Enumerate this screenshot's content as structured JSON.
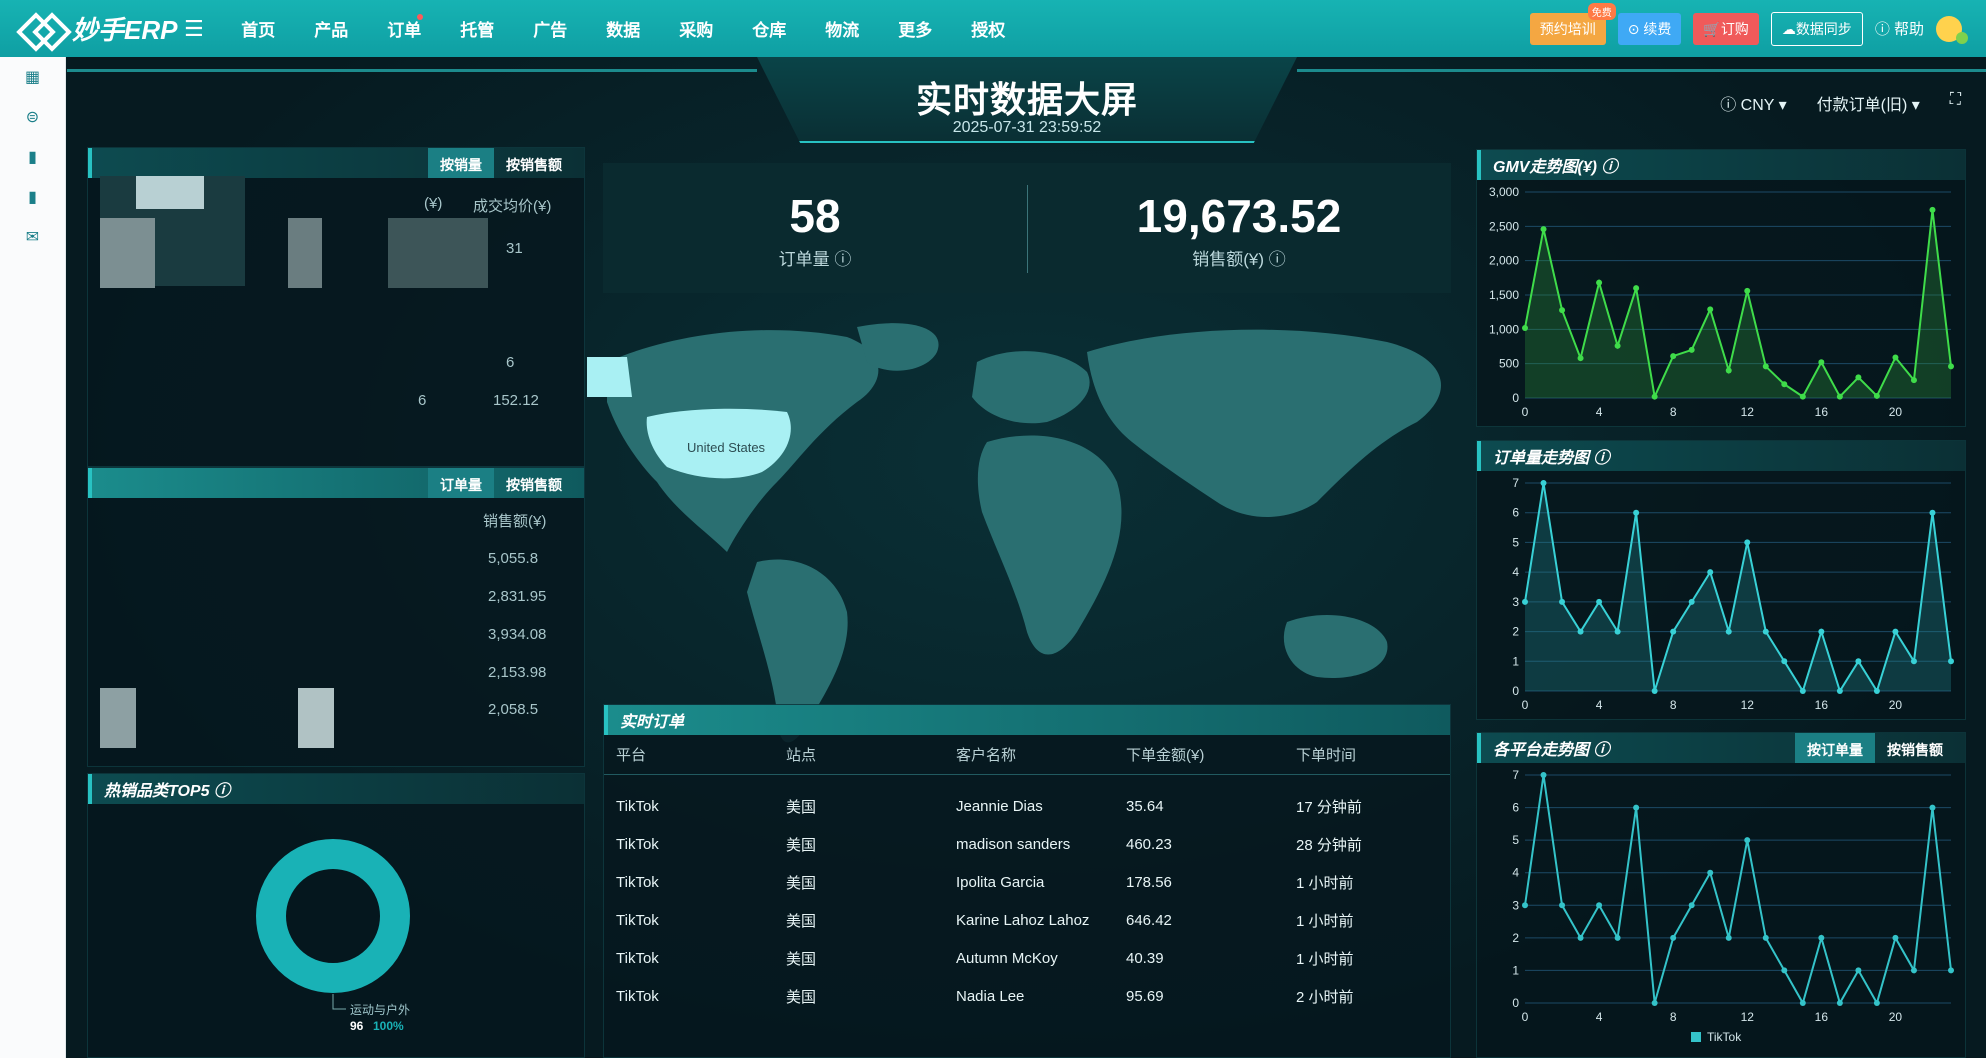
{
  "topnav": {
    "brand": "妙手ERP",
    "items": [
      "首页",
      "产品",
      "订单",
      "托管",
      "广告",
      "数据",
      "采购",
      "仓库",
      "物流",
      "更多",
      "授权"
    ],
    "training_label": "预约培训",
    "free_badge": "免费",
    "renew_label": "续费",
    "order_label": "订购",
    "sync_label": "数据同步",
    "help_label": "帮助"
  },
  "dashboard": {
    "title": "实时数据大屏",
    "datetime": "2025-07-31 23:59:52",
    "currency": "CNY",
    "order_type": "付款订单(旧)"
  },
  "left_top_panel": {
    "tab_by_volume": "按销量",
    "tab_by_sales": "按销售额",
    "col_label": "成交均价(¥)",
    "col_prefix": "(¥)",
    "values": [
      "31",
      "6",
      "6",
      "152.12"
    ]
  },
  "left_mid_panel": {
    "tab_by_orders": "订单量",
    "tab_by_sales": "按销售额",
    "col_label": "销售额(¥)",
    "values": [
      "5,055.8",
      "2,831.95",
      "3,934.08",
      "2,153.98",
      "2,058.5"
    ]
  },
  "kpi": {
    "orders_value": "58",
    "orders_label": "订单量",
    "sales_value": "19,673.52",
    "sales_label": "销售额(¥)"
  },
  "map": {
    "highlight_label": "United States"
  },
  "orders": {
    "title": "实时订单",
    "columns": [
      "平台",
      "站点",
      "客户名称",
      "下单金额(¥)",
      "下单时间"
    ],
    "rows": [
      [
        "TikTok",
        "美国",
        "Jeannie Dias",
        "35.64",
        "17 分钟前"
      ],
      [
        "TikTok",
        "美国",
        "madison sanders",
        "460.23",
        "28 分钟前"
      ],
      [
        "TikTok",
        "美国",
        "Ipolita Garcia",
        "178.56",
        "1 小时前"
      ],
      [
        "TikTok",
        "美国",
        "Karine Lahoz Lahoz",
        "646.42",
        "1 小时前"
      ],
      [
        "TikTok",
        "美国",
        "Autumn McKoy",
        "40.39",
        "1 小时前"
      ],
      [
        "TikTok",
        "美国",
        "Nadia Lee",
        "95.69",
        "2 小时前"
      ]
    ]
  },
  "hot_categories": {
    "title": "热销品类TOP5",
    "segment_label": "运动与户外",
    "segment_count": "96",
    "segment_pct": "100%"
  },
  "chart_data": [
    {
      "type": "area",
      "title": "GMV走势图(¥)",
      "x": [
        0,
        1,
        2,
        3,
        4,
        5,
        6,
        7,
        8,
        9,
        10,
        11,
        12,
        13,
        14,
        15,
        16,
        17,
        18,
        19,
        20,
        21,
        22,
        23
      ],
      "values": [
        1020,
        2460,
        1280,
        580,
        1680,
        760,
        1600,
        20,
        610,
        700,
        1290,
        400,
        1560,
        460,
        200,
        20,
        520,
        20,
        300,
        30,
        590,
        260,
        2740,
        460
      ],
      "xticks": [
        0,
        4,
        8,
        12,
        16,
        20
      ],
      "yticks": [
        0,
        500,
        1000,
        1500,
        2000,
        2500,
        3000
      ],
      "ylim": [
        0,
        3000
      ]
    },
    {
      "type": "area",
      "title": "订单量走势图",
      "x": [
        0,
        1,
        2,
        3,
        4,
        5,
        6,
        7,
        8,
        9,
        10,
        11,
        12,
        13,
        14,
        15,
        16,
        17,
        18,
        19,
        20,
        21,
        22,
        23
      ],
      "values": [
        3,
        7,
        3,
        2,
        3,
        2,
        6,
        0,
        2,
        3,
        4,
        2,
        5,
        2,
        1,
        0,
        2,
        0,
        1,
        0,
        2,
        1,
        6,
        1
      ],
      "xticks": [
        0,
        4,
        8,
        12,
        16,
        20
      ],
      "yticks": [
        0,
        1,
        2,
        3,
        4,
        5,
        6,
        7
      ],
      "ylim": [
        0,
        7
      ]
    },
    {
      "type": "line",
      "title": "各平台走势图",
      "tab_orders": "按订单量",
      "tab_sales": "按销售额",
      "series": [
        {
          "name": "TikTok",
          "values": [
            3,
            7,
            3,
            2,
            3,
            2,
            6,
            0,
            2,
            3,
            4,
            2,
            5,
            2,
            1,
            0,
            2,
            0,
            1,
            0,
            2,
            1,
            6,
            1
          ]
        }
      ],
      "x": [
        0,
        1,
        2,
        3,
        4,
        5,
        6,
        7,
        8,
        9,
        10,
        11,
        12,
        13,
        14,
        15,
        16,
        17,
        18,
        19,
        20,
        21,
        22,
        23
      ],
      "xticks": [
        0,
        4,
        8,
        12,
        16,
        20
      ],
      "yticks": [
        0,
        1,
        2,
        3,
        4,
        5,
        6,
        7
      ],
      "ylim": [
        0,
        7
      ]
    }
  ]
}
